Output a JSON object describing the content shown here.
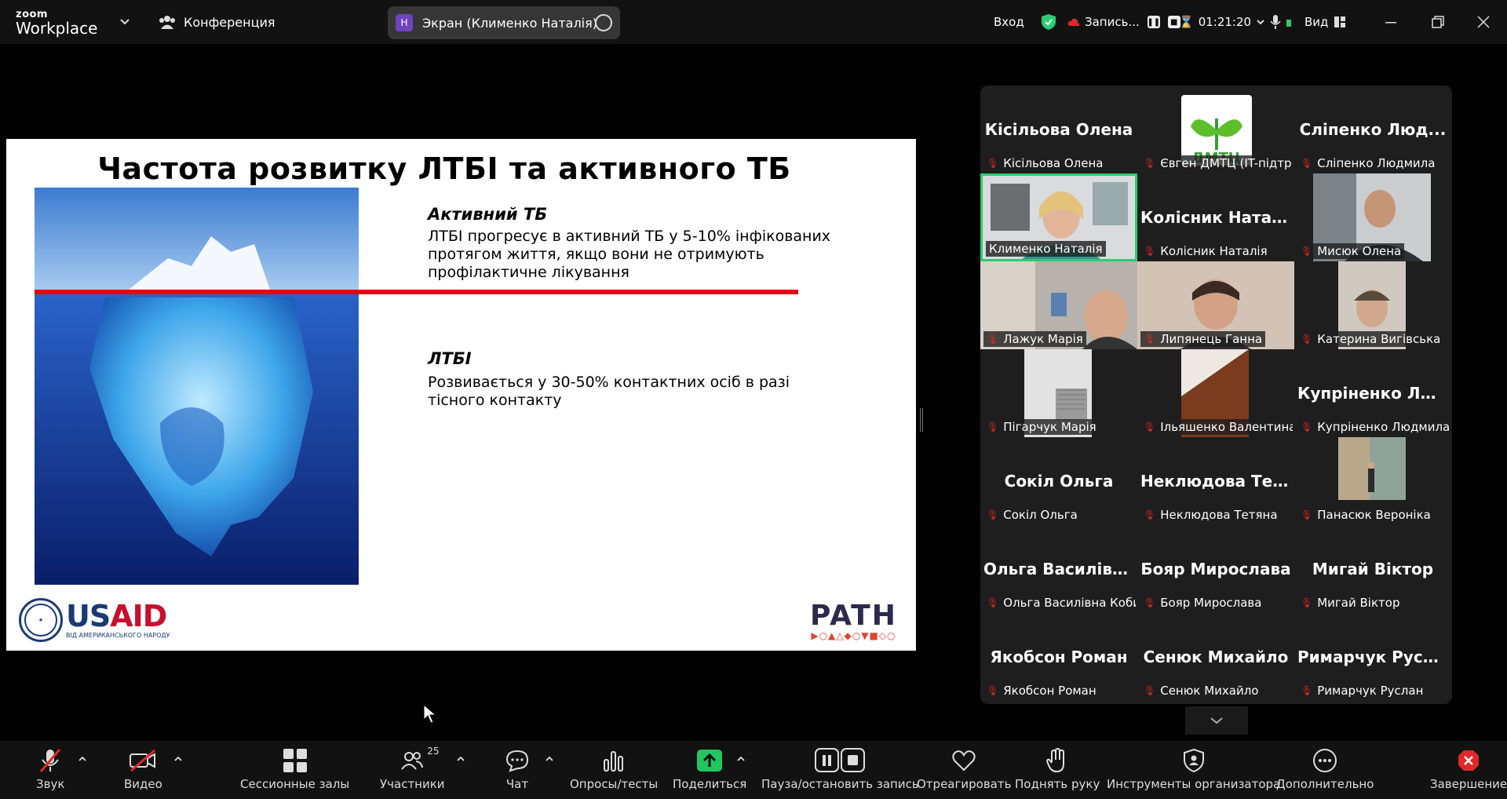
{
  "app": {
    "brand_small": "zoom",
    "brand_big": "Workplace",
    "conference_label": "Конференция"
  },
  "screen_share": {
    "badge": "Н",
    "label": "Экран (Клименко Наталія)"
  },
  "top_right": {
    "enter_label": "Вход",
    "record_label": "Запись...",
    "timer": "01:21:20",
    "view_label": "Вид"
  },
  "slide": {
    "title": "Частота розвитку ЛТБІ та активного ТБ",
    "block1_title": "Активний ТБ",
    "block1_text": "ЛТБІ прогресує в активний ТБ у 5-10% інфікованих протягом життя, якщо вони не отримують профілактичне лікування",
    "block2_title": "ЛТБІ",
    "block2_text": "Розвивається у 30-50% контактних осіб в разі тісного контакту",
    "usaid_us": "US",
    "usaid_aid": "AID",
    "usaid_sub": "ВІД АМЕРИКАНСЬКОГО НАРОДУ",
    "path_word": "PATH",
    "path_shapes": "▶○▲△◆○▼■◇○"
  },
  "participants": [
    {
      "label": "Кісільова Олена",
      "big": "Кісільова Олена"
    },
    {
      "label": "Євген ДМТЦ (IT-підтр..."
    },
    {
      "label": "Сліпенко Людмила",
      "big": "Сліпенко Люд..."
    },
    {
      "label": "Клименко Наталія"
    },
    {
      "label": "Колісник Наталія",
      "big": "Колісник Наталія"
    },
    {
      "label": "Мисюк Олена"
    },
    {
      "label": "Лажук Марія"
    },
    {
      "label": "Липянець Ганна"
    },
    {
      "label": "Катерина Вигівська"
    },
    {
      "label": "Пігарчук Марія"
    },
    {
      "label": "Ільяшенко Валентина"
    },
    {
      "label": "Купріненко Людмила",
      "big": "Купріненко Лю..."
    },
    {
      "label": "Сокіл Ольга",
      "big": "Сокіл Ольга"
    },
    {
      "label": "Неклюдова Тетяна",
      "big": "Неклюдова Тет..."
    },
    {
      "label": "Панасюк Вероніка"
    },
    {
      "label": "Ольга Василівна Коби...",
      "big": "Ольга Василівн..."
    },
    {
      "label": "Бояр Мирослава",
      "big": "Бояр Мирослава"
    },
    {
      "label": "Мигай Віктор",
      "big": "Мигай Віктор"
    },
    {
      "label": "Якобсон Роман",
      "big": "Якобсон Роман"
    },
    {
      "label": "Сенюк Михайло",
      "big": "Сенюк Михайло"
    },
    {
      "label": "Римарчук Руслан",
      "big": "Римарчук Русл..."
    }
  ],
  "dmtc_logo_text": "ДМТЦ",
  "toolbar": {
    "audio": "Звук",
    "video": "Видео",
    "breakout": "Сессионные залы",
    "participants": "Участники",
    "participants_count": "25",
    "chat": "Чат",
    "polls": "Опросы/тесты",
    "share": "Поделиться",
    "pause_record": "Пауза/остановить запись",
    "react": "Отреагировать",
    "raise_hand": "Поднять руку",
    "host_tools": "Инструменты организатора",
    "more": "Дополнительно",
    "end": "Завершение"
  },
  "colors": {
    "active_speaker": "#2ecc71",
    "share_green": "#22c55e",
    "muted_red": "#e02828",
    "slide_red_line": "#e20613",
    "usaid_blue": "#1a3a75",
    "usaid_red": "#c8102e"
  }
}
